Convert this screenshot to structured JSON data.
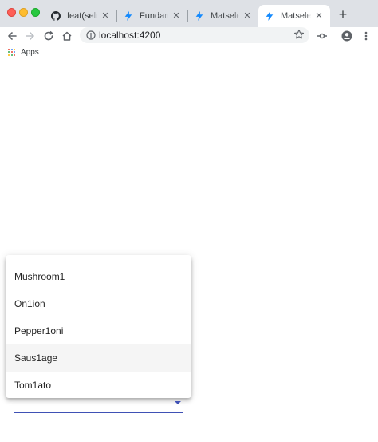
{
  "browser": {
    "tabs": [
      {
        "title": "feat(select",
        "favicon": "github-icon",
        "active": false
      },
      {
        "title": "Fundamen",
        "favicon": "stackblitz-icon",
        "active": false
      },
      {
        "title": "Matselectt",
        "favicon": "stackblitz-icon",
        "active": false
      },
      {
        "title": "Matselectt",
        "favicon": "stackblitz-icon",
        "active": true
      }
    ],
    "new_tab_label": "+",
    "close_label": "✕",
    "url": "localhost:4200",
    "bookmarks": {
      "apps_label": "Apps"
    }
  },
  "select": {
    "options": [
      {
        "label": "Mushroom1",
        "active": false
      },
      {
        "label": "On1ion",
        "active": false
      },
      {
        "label": "Pepper1oni",
        "active": false
      },
      {
        "label": "Saus1age",
        "active": true
      },
      {
        "label": "Tom1ato",
        "active": false
      }
    ]
  },
  "colors": {
    "accent": "#3f51b5",
    "tabstrip": "#dee1e6",
    "stackblitz": "#1389fd"
  }
}
